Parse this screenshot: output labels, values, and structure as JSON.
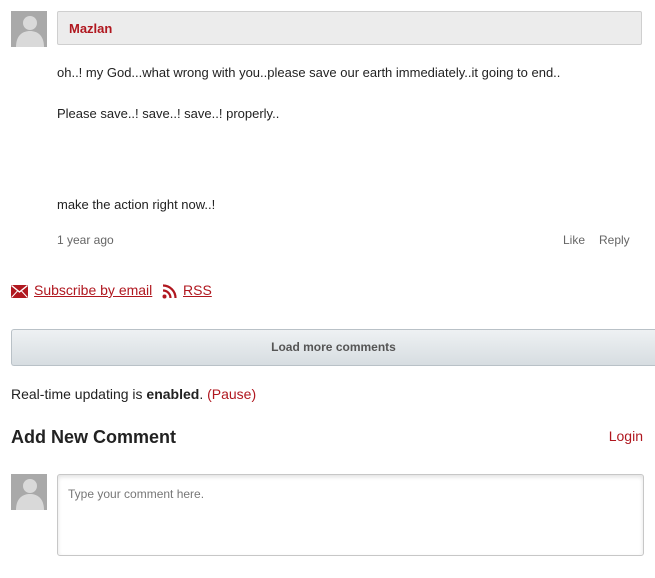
{
  "comment": {
    "author": "Mazlan",
    "paragraphs": [
      "oh..! my God...what wrong with you..please save our earth immediately..it going to end..",
      "Please save..! save..! save..! properly..",
      "make the action right now..!"
    ],
    "timestamp": "1 year ago",
    "like_label": "Like",
    "reply_label": "Reply"
  },
  "subscribe": {
    "email_label": "Subscribe by email",
    "rss_label": "RSS"
  },
  "load_more_label": "Load more comments",
  "realtime": {
    "prefix": "Real-time updating is ",
    "state": "enabled",
    "suffix": ".",
    "pause_label": "(Pause)"
  },
  "add_comment": {
    "title": "Add New Comment",
    "login_label": "Login",
    "placeholder": "Type your comment here."
  },
  "colors": {
    "accent": "#b0171f",
    "avatar": "#a9a9a9"
  },
  "icons": [
    "avatar-icon",
    "email-icon",
    "rss-icon"
  ]
}
